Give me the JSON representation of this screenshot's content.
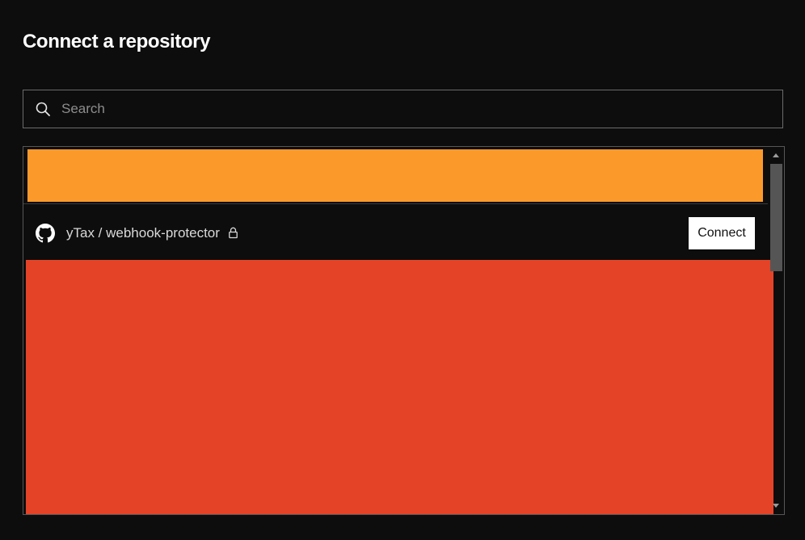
{
  "page": {
    "title": "Connect a repository"
  },
  "search": {
    "placeholder": "Search",
    "value": "",
    "icon": "search-icon"
  },
  "repositories": [
    {
      "name": "yTax / webhook-protector",
      "provider_icon": "github-icon",
      "private": true,
      "private_icon": "lock-icon",
      "action_label": "Connect"
    }
  ],
  "colors": {
    "background": "#0d0d0d",
    "redaction_orange": "#fb9a2b",
    "redaction_red": "#e44328",
    "button_bg": "#ffffff"
  }
}
